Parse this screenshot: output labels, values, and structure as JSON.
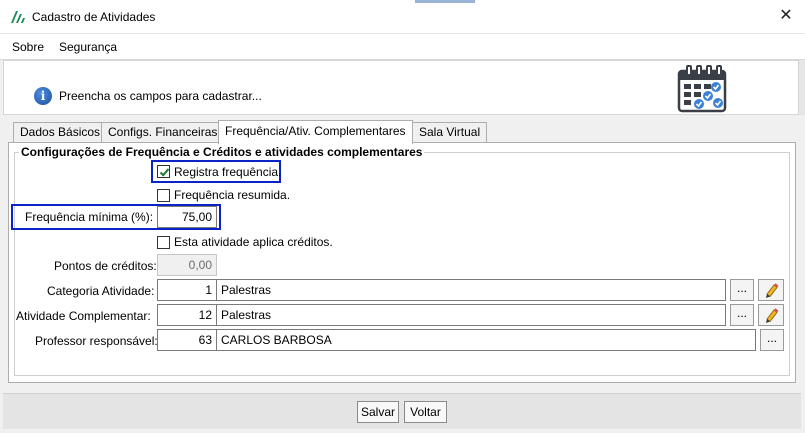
{
  "window": {
    "title": "Cadastro de Atividades",
    "close_glyph": "✕"
  },
  "menu": {
    "items": [
      "Sobre",
      "Segurança"
    ]
  },
  "info": {
    "message": "Preencha os campos para cadastrar..."
  },
  "tabs": [
    {
      "label": "Dados Básicos",
      "active": false
    },
    {
      "label": "Configs. Financeiras",
      "active": false
    },
    {
      "label": "Frequência/Ativ. Complementares",
      "active": true
    },
    {
      "label": "Sala Virtual",
      "active": false
    }
  ],
  "group": {
    "title": "Configurações de Frequência e Créditos e atividades complementares",
    "registra_frequencia": {
      "label": "Registra frequência.",
      "checked": true
    },
    "frequencia_resumida": {
      "label": "Frequência resumida.",
      "checked": false
    },
    "frequencia_minima": {
      "label": "Frequência mínima (%):",
      "value": "75,00"
    },
    "aplica_creditos": {
      "label": "Esta atividade aplica créditos.",
      "checked": false
    },
    "pontos_creditos": {
      "label": "Pontos de créditos:",
      "value": "0,00"
    },
    "categoria": {
      "label": "Categoria Atividade:",
      "code": "1",
      "name": "Palestras"
    },
    "complementar": {
      "label": "Atividade Complementar:",
      "code": "12",
      "name": "Palestras"
    },
    "professor": {
      "label": "Professor responsável:",
      "code": "63",
      "name": "CARLOS BARBOSA"
    },
    "lookup_label": "..."
  },
  "footer": {
    "save_label": "Salvar",
    "back_label": "Voltar"
  },
  "colors": {
    "highlight": "#0a22c8",
    "accent_check": "#1e7a2e"
  }
}
